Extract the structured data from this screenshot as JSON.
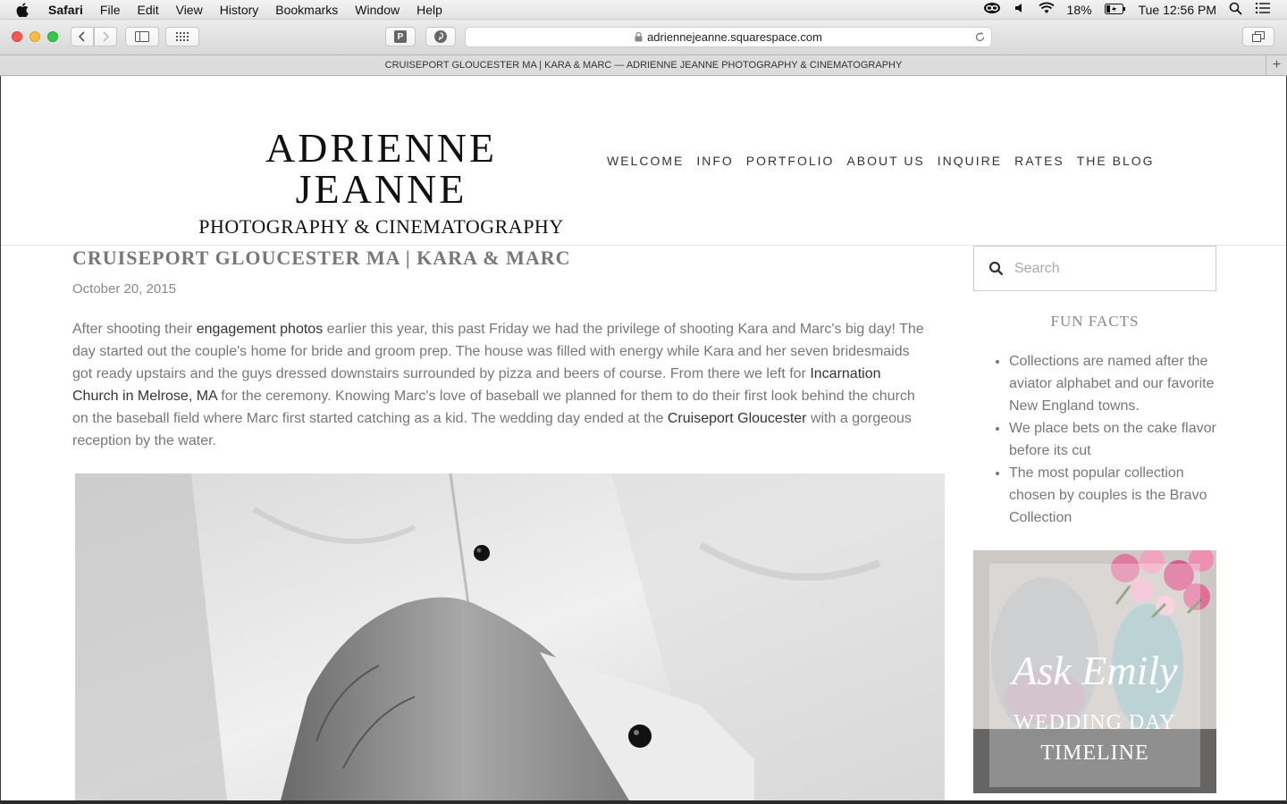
{
  "menubar": {
    "app": "Safari",
    "items": [
      "File",
      "Edit",
      "View",
      "History",
      "Bookmarks",
      "Window",
      "Help"
    ],
    "battery": "18%",
    "clock": "Tue 12:56 PM"
  },
  "browser": {
    "url": "adriennejeanne.squarespace.com",
    "tab_title": "CRUISEPORT GLOUCESTER MA | KARA & MARC — ADRIENNE JEANNE PHOTOGRAPHY & CINEMATOGRAPHY",
    "pocket_label": "P"
  },
  "site": {
    "logo_line1": "ADRIENNE JEANNE",
    "logo_line2": "PHOTOGRAPHY & CINEMATOGRAPHY",
    "nav": [
      "WELCOME",
      "INFO",
      "PORTFOLIO",
      "ABOUT US",
      "INQUIRE",
      "RATES",
      "THE BLOG"
    ]
  },
  "post": {
    "title": "CRUISEPORT GLOUCESTER MA | KARA & MARC",
    "date": "October 20, 2015",
    "body": {
      "p1": "After shooting their ",
      "link1": "engagement photos",
      "p2": " earlier this year, this past Friday we had the privilege of shooting Kara and Marc's big day! The day started out the couple's home for bride and groom prep. The house was filled with energy while Kara and her seven bridesmaids got ready upstairs and the guys dressed downstairs surrounded by pizza and beers of course. From there we left for ",
      "link2": "Incarnation Church in Melrose, MA",
      "p3": " for the ceremony. Knowing Marc's love of baseball we planned for them to do their first look behind the church on the baseball field where Marc first started catching as a kid. The wedding day ended at the ",
      "link3": "Cruiseport Gloucester",
      "p4": " with a gorgeous reception by the water."
    }
  },
  "sidebar": {
    "search_placeholder": "Search",
    "fun_facts_title": "FUN FACTS",
    "facts": [
      "Collections are named after the aviator alphabet and our favorite New England towns.",
      "We place bets on the cake flavor before its cut",
      "The most popular collection chosen by couples is the Bravo Collection"
    ],
    "promo_script": "Ask Emily",
    "promo_line1": "WEDDING DAY",
    "promo_line2": "TIMELINE"
  }
}
